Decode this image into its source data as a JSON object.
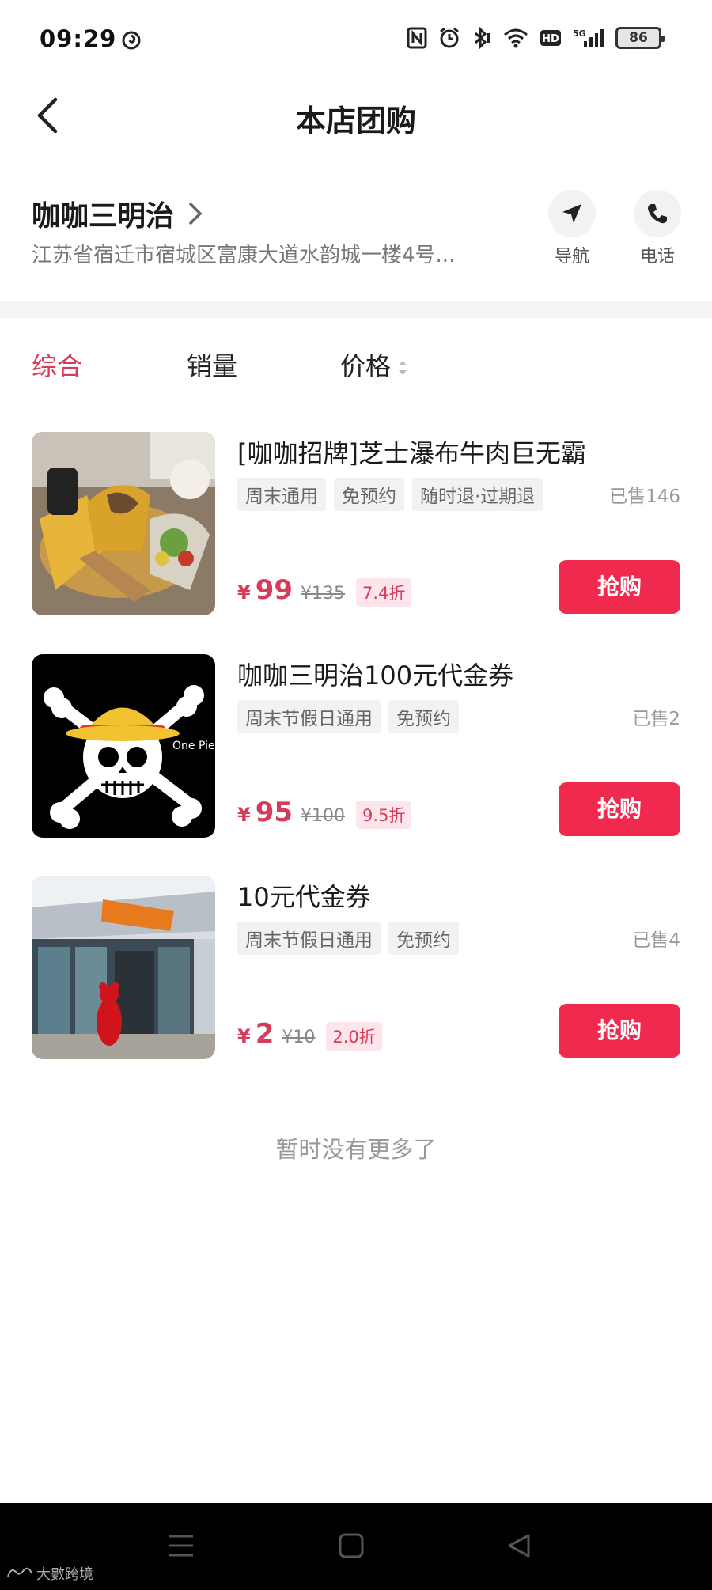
{
  "status_bar": {
    "time": "09:29",
    "network": "5G",
    "battery": "86"
  },
  "header": {
    "title": "本店团购"
  },
  "store": {
    "name": "咖咖三明治",
    "address": "江苏省宿迁市宿城区富康大道水韵城一楼4号...",
    "actions": [
      {
        "label": "导航",
        "icon": "navigation-icon"
      },
      {
        "label": "电话",
        "icon": "phone-icon"
      }
    ]
  },
  "sort_tabs": [
    {
      "label": "综合",
      "active": true
    },
    {
      "label": "销量",
      "active": false
    },
    {
      "label": "价格",
      "active": false
    }
  ],
  "deals": [
    {
      "title": "[咖咖招牌]芝士瀑布牛肉巨无霸",
      "tags": [
        "周末通用",
        "免预约",
        "随时退·过期退"
      ],
      "sold": "已售146",
      "currency": "¥",
      "price": "99",
      "original_price": "¥135",
      "discount": "7.4折",
      "button": "抢购"
    },
    {
      "title": "咖咖三明治100元代金券",
      "tags": [
        "周末节假日通用",
        "免预约"
      ],
      "sold": "已售2",
      "currency": "¥",
      "price": "95",
      "original_price": "¥100",
      "discount": "9.5折",
      "button": "抢购"
    },
    {
      "title": "10元代金券",
      "tags": [
        "周末节假日通用",
        "免预约"
      ],
      "sold": "已售4",
      "currency": "¥",
      "price": "2",
      "original_price": "¥10",
      "discount": "2.0折",
      "button": "抢购"
    }
  ],
  "thumb_texts": {
    "skull_caption": "One Piec"
  },
  "footer_text": "暂时没有更多了",
  "watermark": "大數跨境",
  "colors": {
    "accent": "#d63c5c",
    "buy_button": "#f0294f"
  }
}
